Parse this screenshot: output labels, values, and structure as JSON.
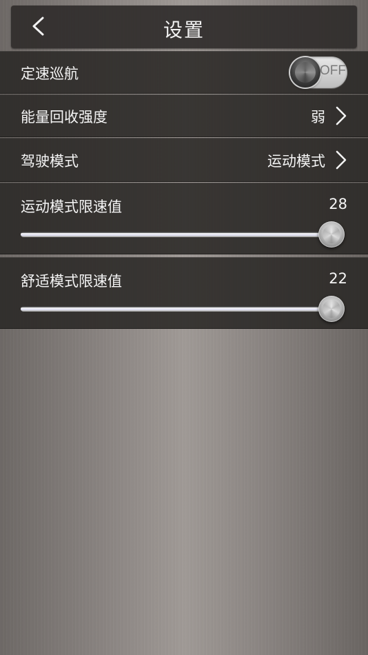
{
  "header": {
    "title": "设置",
    "back_icon": "chevron-left-icon"
  },
  "cruise": {
    "label": "定速巡航",
    "toggle_state": "OFF",
    "on": false
  },
  "regen": {
    "label": "能量回收强度",
    "value": "弱"
  },
  "drive_mode": {
    "label": "驾驶模式",
    "value": "运动模式"
  },
  "sport_limit": {
    "label": "运动模式限速值",
    "value": "28",
    "level": 1.0
  },
  "comfort_limit": {
    "label": "舒适模式限速值",
    "value": "22",
    "level": 1.0
  }
}
